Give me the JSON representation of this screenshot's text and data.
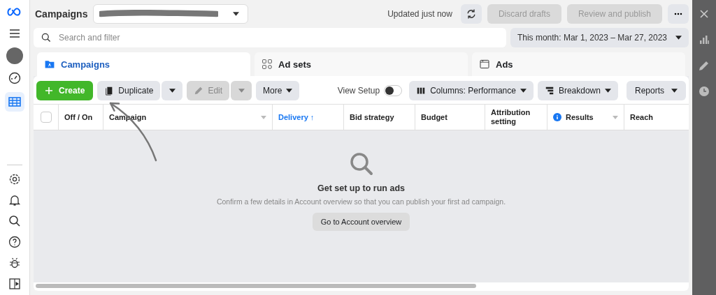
{
  "header": {
    "title": "Campaigns",
    "status": "Updated just now",
    "buttons": [
      {
        "label": "Discard drafts",
        "disabled": true
      },
      {
        "label": "Review and publish",
        "disabled": true
      }
    ]
  },
  "search": {
    "placeholder": "Search and filter"
  },
  "date_range": "This month: Mar 1, 2023 – Mar 27, 2023",
  "tabs": [
    {
      "label": "Campaigns",
      "selected": true,
      "kind": "folder"
    },
    {
      "label": "Ad sets",
      "selected": false,
      "kind": "grid"
    },
    {
      "label": "Ads",
      "selected": false,
      "kind": "window"
    }
  ],
  "toolbar": {
    "create": "Create",
    "duplicate": "Duplicate",
    "edit": {
      "label": "Edit",
      "disabled": true
    },
    "more": "More",
    "view_setup": {
      "label": "View Setup",
      "on": false
    },
    "columns": "Columns: Performance",
    "breakdown": "Breakdown",
    "reports": "Reports"
  },
  "table": {
    "columns": [
      {
        "label": "Off / On",
        "sorted": false,
        "kind": "plain"
      },
      {
        "label": "Campaign",
        "sorted": false,
        "kind": "menu"
      },
      {
        "label": "Delivery ↑",
        "sorted": true,
        "kind": "plain"
      },
      {
        "label": "Bid strategy",
        "sorted": false,
        "kind": "plain"
      },
      {
        "label": "Budget",
        "sorted": false,
        "kind": "plain"
      },
      {
        "label": "Attribution setting",
        "sorted": false,
        "kind": "plain"
      },
      {
        "label": "Results",
        "sorted": false,
        "kind": "info"
      },
      {
        "label": "Reach",
        "sorted": false,
        "kind": "plain"
      }
    ],
    "all_checked": false
  },
  "empty_state": {
    "title": "Get set up to run ads",
    "message": "Confirm a few details in Account overview so that you can publish your first ad campaign.",
    "button": "Go to Account overview"
  }
}
